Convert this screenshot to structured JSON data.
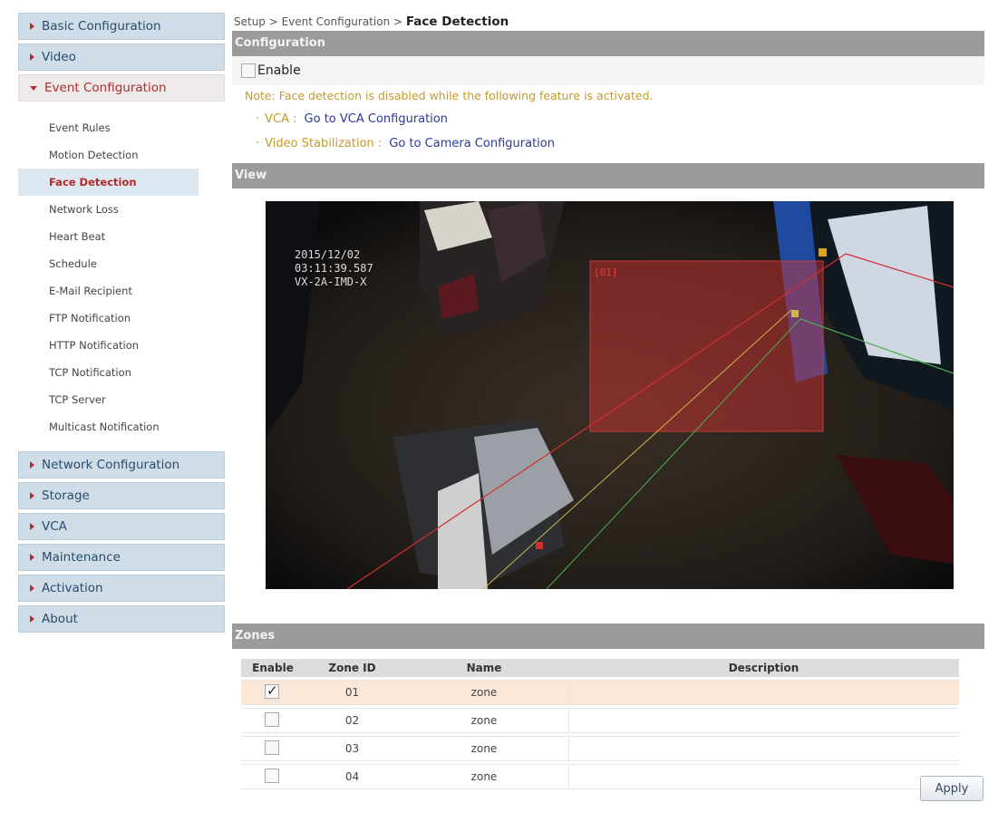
{
  "sidebar": {
    "top_items": [
      {
        "label": "Basic Configuration"
      },
      {
        "label": "Video"
      }
    ],
    "event": {
      "label": "Event Configuration",
      "items": [
        {
          "label": "Event Rules"
        },
        {
          "label": "Motion Detection"
        },
        {
          "label": "Face Detection"
        },
        {
          "label": "Network Loss"
        },
        {
          "label": "Heart Beat"
        },
        {
          "label": "Schedule"
        },
        {
          "label": "E-Mail Recipient"
        },
        {
          "label": "FTP Notification"
        },
        {
          "label": "HTTP Notification"
        },
        {
          "label": "TCP Notification"
        },
        {
          "label": "TCP Server"
        },
        {
          "label": "Multicast Notification"
        }
      ]
    },
    "bottom_items": [
      {
        "label": "Network Configuration"
      },
      {
        "label": "Storage"
      },
      {
        "label": "VCA"
      },
      {
        "label": "Maintenance"
      },
      {
        "label": "Activation"
      },
      {
        "label": "About"
      }
    ]
  },
  "breadcrumb": {
    "prefix": "Setup > Event Configuration > ",
    "current": "Face Detection"
  },
  "configuration": {
    "title": "Configuration",
    "enable_label": "Enable",
    "note": "Note: Face detection is disabled while the following feature is activated.",
    "links": [
      {
        "feature": "VCA :",
        "link": "Go to VCA Configuration"
      },
      {
        "feature": "Video Stabilization :",
        "link": "Go to Camera Configuration"
      }
    ]
  },
  "view": {
    "title": "View",
    "osd_date": "2015/12/02",
    "osd_time": "03:11:39.587",
    "osd_camera": "VX-2A-IMD-X",
    "zone_tag": "[01]"
  },
  "zones": {
    "title": "Zones",
    "columns": [
      "Enable",
      "Zone ID",
      "Name",
      "Description"
    ],
    "rows": [
      {
        "enabled": true,
        "id": "01",
        "name": "zone",
        "description": ""
      },
      {
        "enabled": false,
        "id": "02",
        "name": "zone",
        "description": ""
      },
      {
        "enabled": false,
        "id": "03",
        "name": "zone",
        "description": ""
      },
      {
        "enabled": false,
        "id": "04",
        "name": "zone",
        "description": ""
      }
    ]
  },
  "apply_label": "Apply",
  "colors": {
    "section_bar": "#9b9b9b",
    "sidebar_head": "#cfdde8",
    "active_text": "#b02a2a",
    "note_text": "#c49a2a",
    "link_text": "#2b3a9c",
    "selected_row": "#fbe7d8"
  }
}
